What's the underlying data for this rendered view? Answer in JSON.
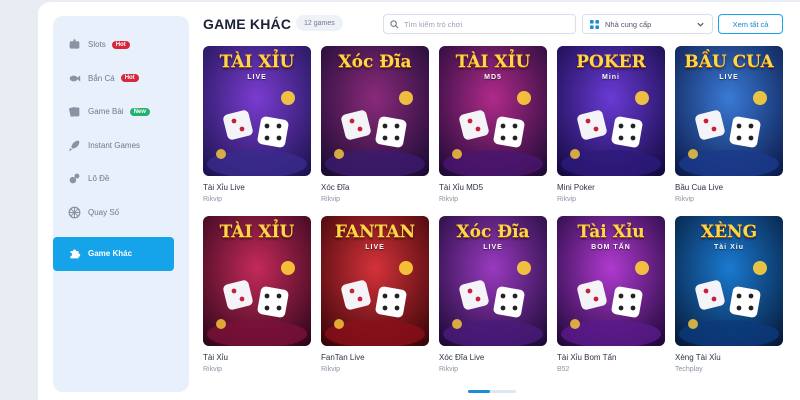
{
  "sidebar": {
    "items": [
      {
        "label": "Slots",
        "icon": "slot-machine-icon",
        "badge": "Hot",
        "badge_color": "#d6283a"
      },
      {
        "label": "Bắn Cá",
        "icon": "fish-icon",
        "badge": "Hot",
        "badge_color": "#d6283a"
      },
      {
        "label": "Game Bài",
        "icon": "cards-icon",
        "badge": "New",
        "badge_color": "#23b26d"
      },
      {
        "label": "Instant Games",
        "icon": "rocket-icon",
        "badge": "",
        "badge_color": ""
      },
      {
        "label": "Lô Đề",
        "icon": "lottery-balls-icon",
        "badge": "",
        "badge_color": ""
      },
      {
        "label": "Quay Số",
        "icon": "wheel-icon",
        "badge": "",
        "badge_color": ""
      },
      {
        "label": "Game Khác",
        "icon": "puzzle-icon",
        "badge": "",
        "badge_color": "",
        "active": true
      }
    ]
  },
  "header": {
    "title": "GAME KHÁC",
    "count": "12 games",
    "search_placeholder": "Tìm kiếm trò chơi",
    "provider_label": "Nhà cung cấp",
    "see_all": "Xem tất cả"
  },
  "games": [
    {
      "name": "Tài Xỉu Live",
      "provider": "Rikvip",
      "logo": "TÀI XỈU",
      "sub": "LIVE"
    },
    {
      "name": "Xóc Đĩa",
      "provider": "Rikvip",
      "logo": "Xóc Đĩa",
      "sub": ""
    },
    {
      "name": "Tài Xỉu MD5",
      "provider": "Rikvip",
      "logo": "TÀI XỈU",
      "sub": "MD5"
    },
    {
      "name": "Mini Poker",
      "provider": "Rikvip",
      "logo": "POKER",
      "sub": "Mini"
    },
    {
      "name": "Bầu Cua Live",
      "provider": "Rikvip",
      "logo": "BẦU CUA",
      "sub": "LIVE"
    },
    {
      "name": "Tài Xỉu",
      "provider": "Rikvip",
      "logo": "TÀI XỈU",
      "sub": ""
    },
    {
      "name": "FanTan Live",
      "provider": "Rikvip",
      "logo": "FANTAN",
      "sub": "LIVE"
    },
    {
      "name": "Xóc Đĩa Live",
      "provider": "Rikvip",
      "logo": "Xóc Đĩa",
      "sub": "LIVE"
    },
    {
      "name": "Tài Xỉu Bom Tấn",
      "provider": "B52",
      "logo": "Tài Xỉu",
      "sub": "BOM TẤN"
    },
    {
      "name": "Xèng Tài Xỉu",
      "provider": "Techplay",
      "logo": "XÈNG",
      "sub": "Tài Xỉu"
    }
  ],
  "colors": {
    "accent": "#15a3e9",
    "sidebar_bg": "#e7f0fb",
    "hot_badge": "#d6283a",
    "new_badge": "#23b26d"
  },
  "pagination": {
    "pages": 2,
    "current": 1
  }
}
